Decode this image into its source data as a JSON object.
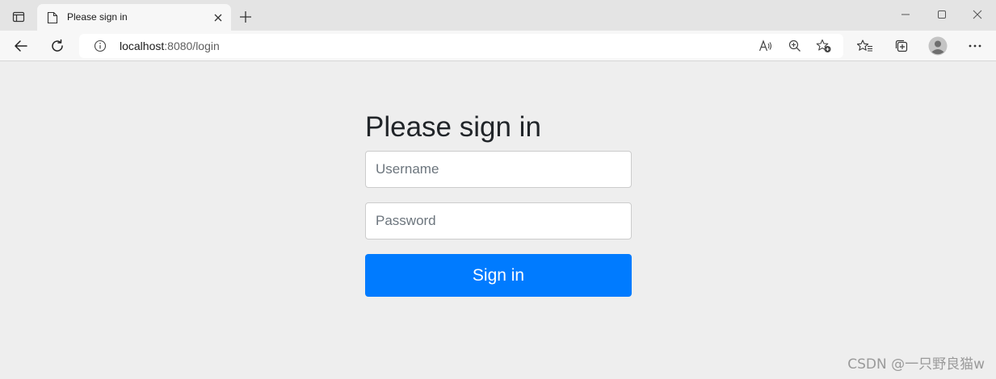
{
  "browser": {
    "tab": {
      "title": "Please sign in"
    },
    "address": {
      "host": "localhost",
      "path": ":8080/login"
    }
  },
  "page": {
    "heading": "Please sign in",
    "username_placeholder": "Username",
    "password_placeholder": "Password",
    "submit_label": "Sign in"
  },
  "watermark": "CSDN @一只野良猫w",
  "icons": [
    "tab-actions-icon",
    "page-icon",
    "close-icon",
    "plus-icon",
    "minimize-icon",
    "maximize-icon",
    "window-close-icon",
    "back-arrow-icon",
    "refresh-icon",
    "info-icon",
    "read-aloud-icon",
    "zoom-icon",
    "add-favorite-icon",
    "favorites-icon",
    "collections-icon",
    "profile-avatar-icon",
    "more-icon"
  ],
  "colors": {
    "primary_button": "#007bff",
    "page_background": "#eeeeee",
    "heading_text": "#212529"
  }
}
